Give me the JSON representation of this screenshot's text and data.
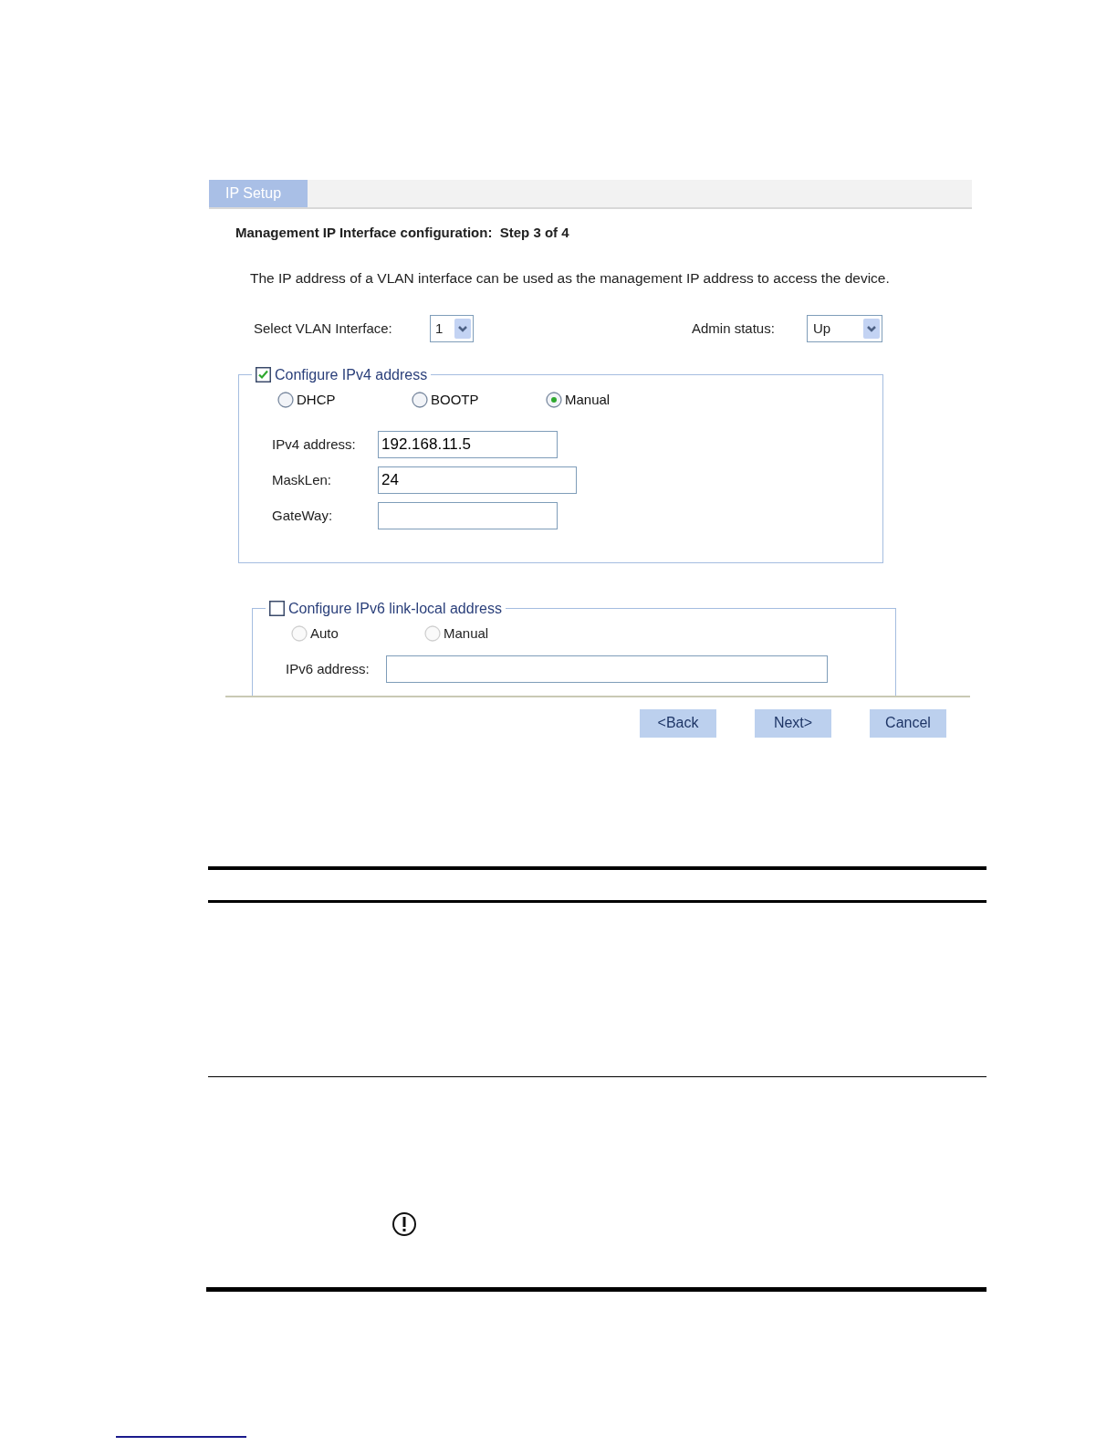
{
  "tab": {
    "label": "IP Setup",
    "selected": true
  },
  "heading": "Management IP Interface configuration:  Step 3 of 4",
  "description": "The IP address of a VLAN interface can be used as the management IP address to access the device.",
  "vlan": {
    "label": "Select VLAN Interface:",
    "value": "1"
  },
  "admin_status": {
    "label": "Admin status:",
    "value": "Up"
  },
  "ipv4": {
    "legend": "Configure IPv4 address",
    "checked": true,
    "modes": [
      {
        "label": "DHCP",
        "selected": false,
        "disabled": false
      },
      {
        "label": "BOOTP",
        "selected": false,
        "disabled": false
      },
      {
        "label": "Manual",
        "selected": true,
        "disabled": false
      }
    ],
    "fields": [
      {
        "label": "IPv4 address:",
        "value": "192.168.11.5"
      },
      {
        "label": "MaskLen:",
        "value": "24"
      },
      {
        "label": "GateWay:"
      }
    ]
  },
  "ipv6": {
    "legend": "Configure IPv6 link-local address",
    "checked": false,
    "modes": [
      {
        "label": "Auto",
        "selected": false,
        "disabled": true
      },
      {
        "label": "Manual",
        "selected": false,
        "disabled": true
      }
    ],
    "fields": [
      {
        "label": "IPv6 address:"
      }
    ]
  },
  "buttons": [
    "<Back",
    "Next>",
    "Cancel"
  ]
}
